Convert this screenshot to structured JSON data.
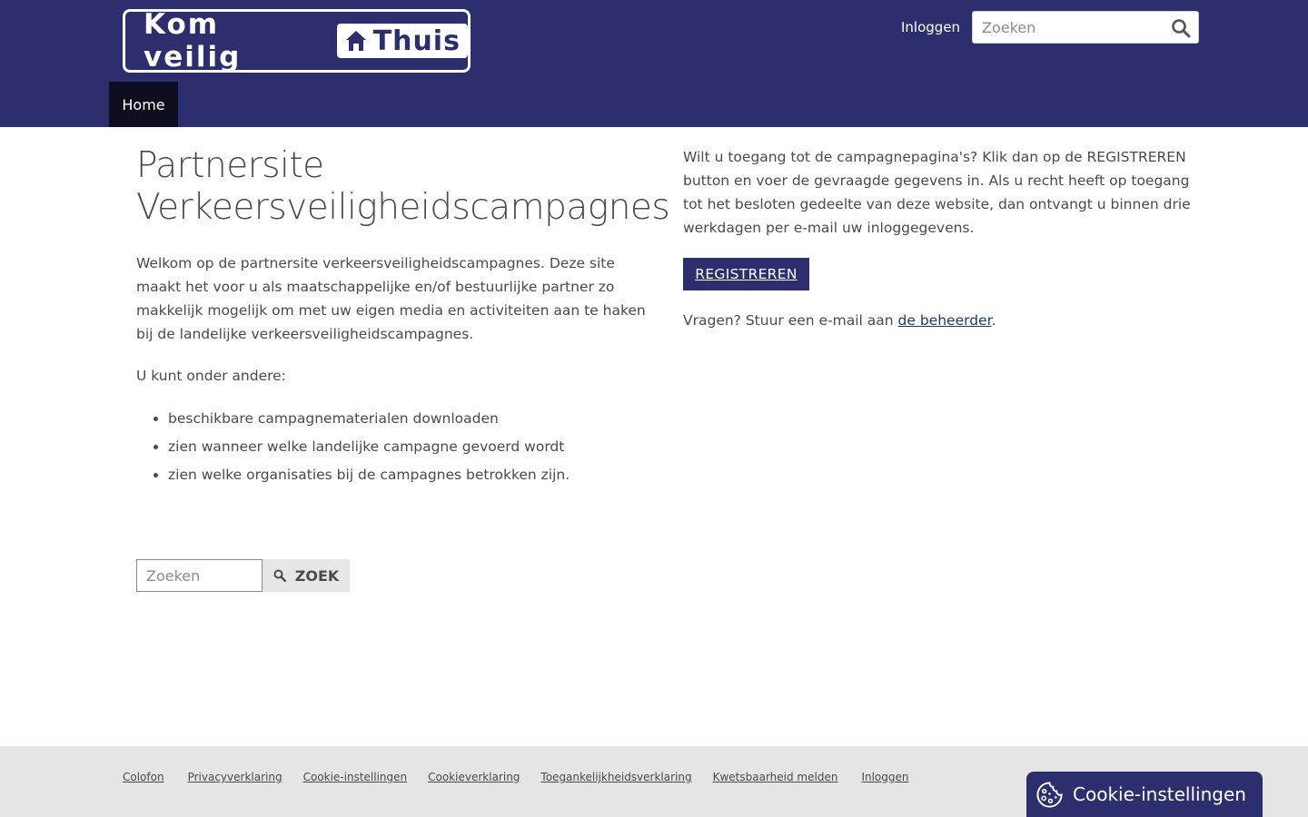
{
  "header": {
    "logo_text": "Kom veilig",
    "logo_box_text": "Thuis",
    "login_label": "Inloggen",
    "search_placeholder": "Zoeken",
    "nav": [
      {
        "label": "Home"
      }
    ]
  },
  "main": {
    "title": "Partnersite Verkeersveiligheidscampagnes",
    "intro": "Welkom op de partnersite verkeersveiligheidscampagnes. Deze site maakt het voor u als maatschappelijke en/of bestuurlijke partner zo makkelijk mogelijk om met uw eigen media en activiteiten aan te haken bij de landelijke verkeersveiligheidscampagnes.",
    "sub_intro": "U kunt onder andere:",
    "features": [
      "beschikbare campagnematerialen downloaden",
      "zien wanneer welke landelijke campagne gevoerd wordt",
      "zien welke organisaties bij de campagnes betrokken zijn."
    ],
    "search_placeholder": "Zoeken",
    "search_button": "ZOEK"
  },
  "sidebar": {
    "text": "Wilt u toegang tot de campagnepagina's? Klik dan op de REGISTREREN button en voer de gevraagde gegevens in. Als u recht heeft op toegang tot het besloten gedeelte van deze website, dan ontvangt u binnen drie werkdagen per e-mail uw inloggegevens.",
    "register_label": "REGISTREREN",
    "questions_prefix": "Vragen? Stuur een e-mail aan ",
    "questions_link": "de beheerder",
    "questions_suffix": "."
  },
  "footer": {
    "links": [
      "Colofon",
      "Privacyverklaring",
      "Cookie-instellingen",
      "Cookieverklaring",
      "Toegankelijkheidsverklaring",
      "Kwetsbaarheid melden",
      "Inloggen"
    ]
  },
  "cookie_button": {
    "label": "Cookie-instellingen"
  },
  "colors": {
    "brand": "#2c2e6e",
    "nav_active": "#0d0e1f",
    "footer_bg": "#e5e5e5"
  }
}
